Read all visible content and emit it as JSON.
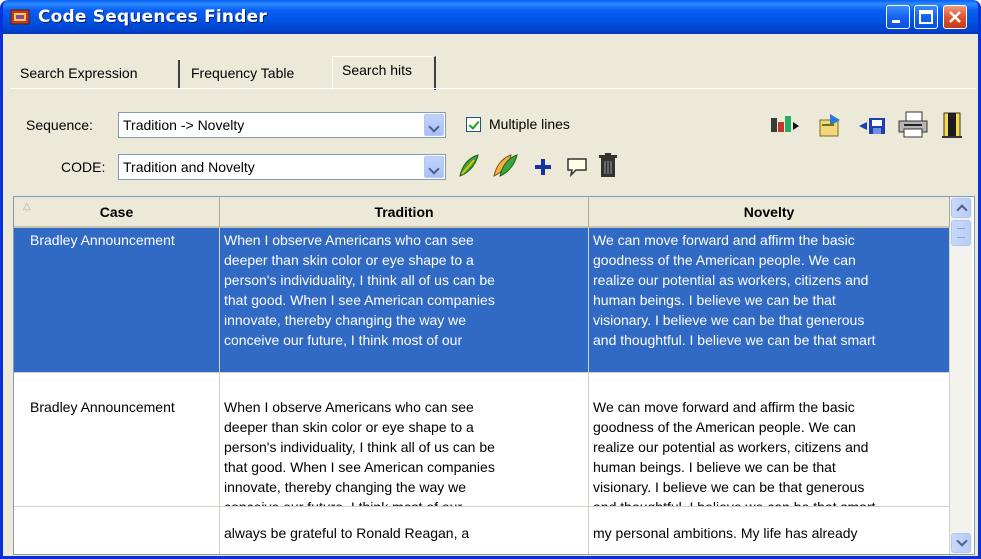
{
  "window": {
    "title": "Code Sequences Finder"
  },
  "tabs": [
    {
      "label": "Search Expression",
      "active": false
    },
    {
      "label": "Frequency Table",
      "active": false
    },
    {
      "label": "Search hits",
      "active": true
    }
  ],
  "form": {
    "sequence_label": "Sequence:",
    "sequence_value": "Tradition -> Novelty",
    "multiple_lines_label": "Multiple lines",
    "multiple_lines_checked": true,
    "code_label": "CODE:",
    "code_value": "Tradition and Novelty"
  },
  "toolbar_icons": [
    "export-icon",
    "import-icon",
    "save-icon",
    "print-icon",
    "exit-icon"
  ],
  "code_icons": [
    "add-code-icon",
    "add-multiple-codes-icon",
    "plus-icon",
    "comment-icon",
    "delete-icon"
  ],
  "grid": {
    "columns": [
      "Case",
      "Tradition",
      "Novelty"
    ],
    "rows": [
      {
        "case": "Bradley Announcement",
        "tradition": [
          "When I observe Americans who can see",
          "deeper than skin color or eye shape to a",
          "person's individuality, I think all of us can be",
          "that good. When I see American companies",
          "innovate, thereby changing the way we",
          "conceive our future, I think most of our"
        ],
        "novelty": [
          "We can move forward and affirm the basic",
          "goodness of the American people. We can",
          "realize our potential as workers, citizens and",
          "human beings. I believe we can be that",
          "visionary. I believe we can be that generous",
          "and thoughtful. I believe we can be that smart"
        ],
        "selected": true
      },
      {
        "case": "Bradley Announcement",
        "tradition": [
          "When I observe Americans who can see",
          "deeper than skin color or eye shape to a",
          "person's individuality, I think all of us can be",
          "that good. When I see American companies",
          "innovate, thereby changing the way we",
          "conceive our future. I think most of our"
        ],
        "novelty": [
          "We can move forward and affirm the basic",
          "goodness of the American people. We can",
          "realize our potential as workers, citizens and",
          "human beings. I believe we can be that",
          "visionary. I believe we can be that generous",
          "and thoughtful. I believe we can be that smart"
        ],
        "selected": false
      },
      {
        "case": "",
        "tradition": [
          "always be grateful to Ronald Reagan, a"
        ],
        "novelty": [
          "my personal ambitions. My life has already"
        ],
        "selected": false
      }
    ]
  },
  "colors": {
    "title_bar": "#0054e3",
    "selection": "#316ac5",
    "window_bg": "#ece9d8"
  }
}
